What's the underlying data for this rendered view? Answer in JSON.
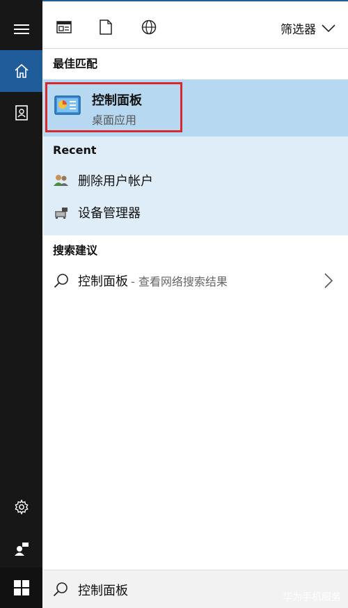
{
  "toolbar": {
    "icons": [
      "apps-icon",
      "document-icon",
      "web-icon"
    ],
    "filter_label": "筛选器"
  },
  "best_match": {
    "heading": "最佳匹配",
    "title": "控制面板",
    "subtitle": "桌面应用"
  },
  "recent": {
    "heading": "Recent",
    "items": [
      {
        "label": "删除用户帐户",
        "icon": "users-icon"
      },
      {
        "label": "设备管理器",
        "icon": "device-manager-icon"
      }
    ]
  },
  "suggestions": {
    "heading": "搜索建议",
    "items": [
      {
        "label": "控制面板",
        "hint": "- 查看网络搜索结果"
      }
    ]
  },
  "search": {
    "value": "控制面板"
  },
  "watermark": "华为手机服务",
  "colors": {
    "rail_bg": "#171717",
    "rail_active": "#1f5c99",
    "best_row_bg": "#b7d8f1",
    "recent_bg": "#deedf8",
    "highlight_border": "#d7282d"
  }
}
